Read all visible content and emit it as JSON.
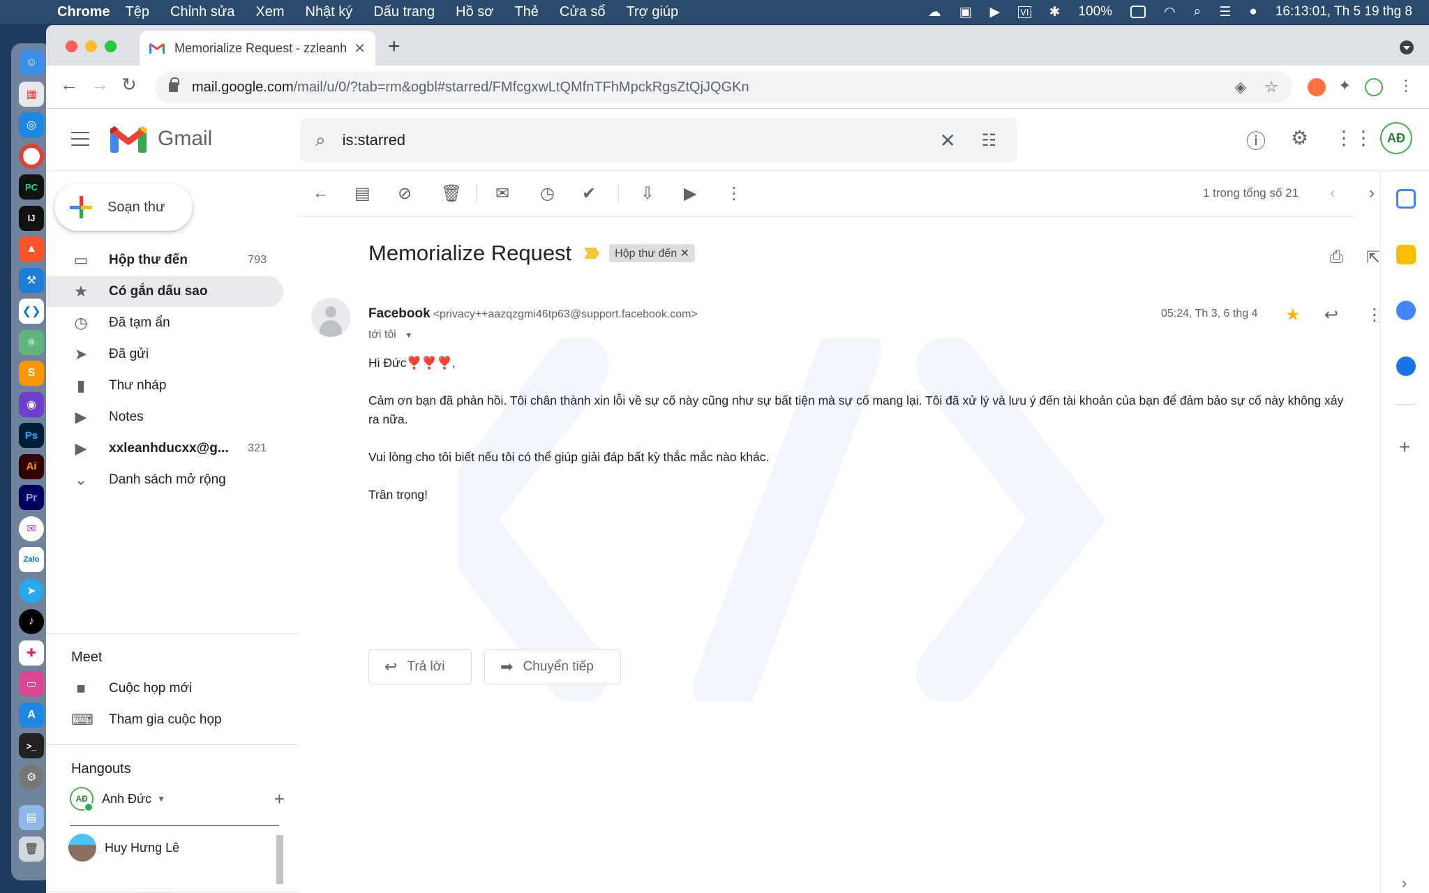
{
  "menubar": {
    "app": "Chrome",
    "items": [
      "Tệp",
      "Chỉnh sửa",
      "Xem",
      "Nhật ký",
      "Dấu trang",
      "Hồ sơ",
      "Thẻ",
      "Cửa sổ",
      "Trợ giúp"
    ],
    "battery": "100%",
    "clock": "16:13:01, Th 5 19 thg 8"
  },
  "browser": {
    "tab_title": "Memorialize Request - zzleanh",
    "url_host": "mail.google.com",
    "url_path": "/mail/u/0/?tab=rm&ogbl#starred/FMfcgxwLtQMfnTFhMpckRgsZtQjJQGKn"
  },
  "gmail": {
    "logo_text": "Gmail",
    "search_value": "is:starred",
    "compose_label": "Soạn thư",
    "nav": [
      {
        "label": "Hộp thư đến",
        "count": "793"
      },
      {
        "label": "Có gắn dấu sao",
        "count": ""
      },
      {
        "label": "Đã tạm ẩn",
        "count": ""
      },
      {
        "label": "Đã gửi",
        "count": ""
      },
      {
        "label": "Thư nháp",
        "count": ""
      },
      {
        "label": "Notes",
        "count": ""
      },
      {
        "label": "xxleanhducxx@g...",
        "count": "321"
      },
      {
        "label": "Danh sách mở rộng",
        "count": ""
      }
    ],
    "meet": {
      "title": "Meet",
      "items": [
        "Cuộc họp mới",
        "Tham gia cuộc họp"
      ]
    },
    "hangouts": {
      "title": "Hangouts",
      "me": "Anh Đức",
      "contact": "Huy Hưng Lê"
    },
    "pager": "1 trong tổng số 21",
    "email": {
      "subject": "Memorialize Request",
      "label_chip": "Hộp thư đến",
      "from_name": "Facebook",
      "from_addr": "<privacy++aazqzgmi46tp63@support.facebook.com>",
      "to": "tới tôi",
      "date": "05:24, Th 3, 6 thg 4",
      "greeting": "Hi Đức❣️❣️❣️,",
      "para1": "Cảm ơn bạn đã phản hồi. Tôi chân thành xin lỗi về sự cố này cũng như sự bất tiện mà sự cố mang lại. Tôi đã xử lý và lưu ý đến tài khoản của bạn để đảm bảo sự cố này không xảy ra nữa.",
      "para2": "Vui lòng cho tôi biết nếu tôi có thể giúp giải đáp bất kỳ thắc mắc nào khác.",
      "closing": "Trân trọng!",
      "reply_label": "Trả lời",
      "forward_label": "Chuyển tiếp"
    }
  }
}
